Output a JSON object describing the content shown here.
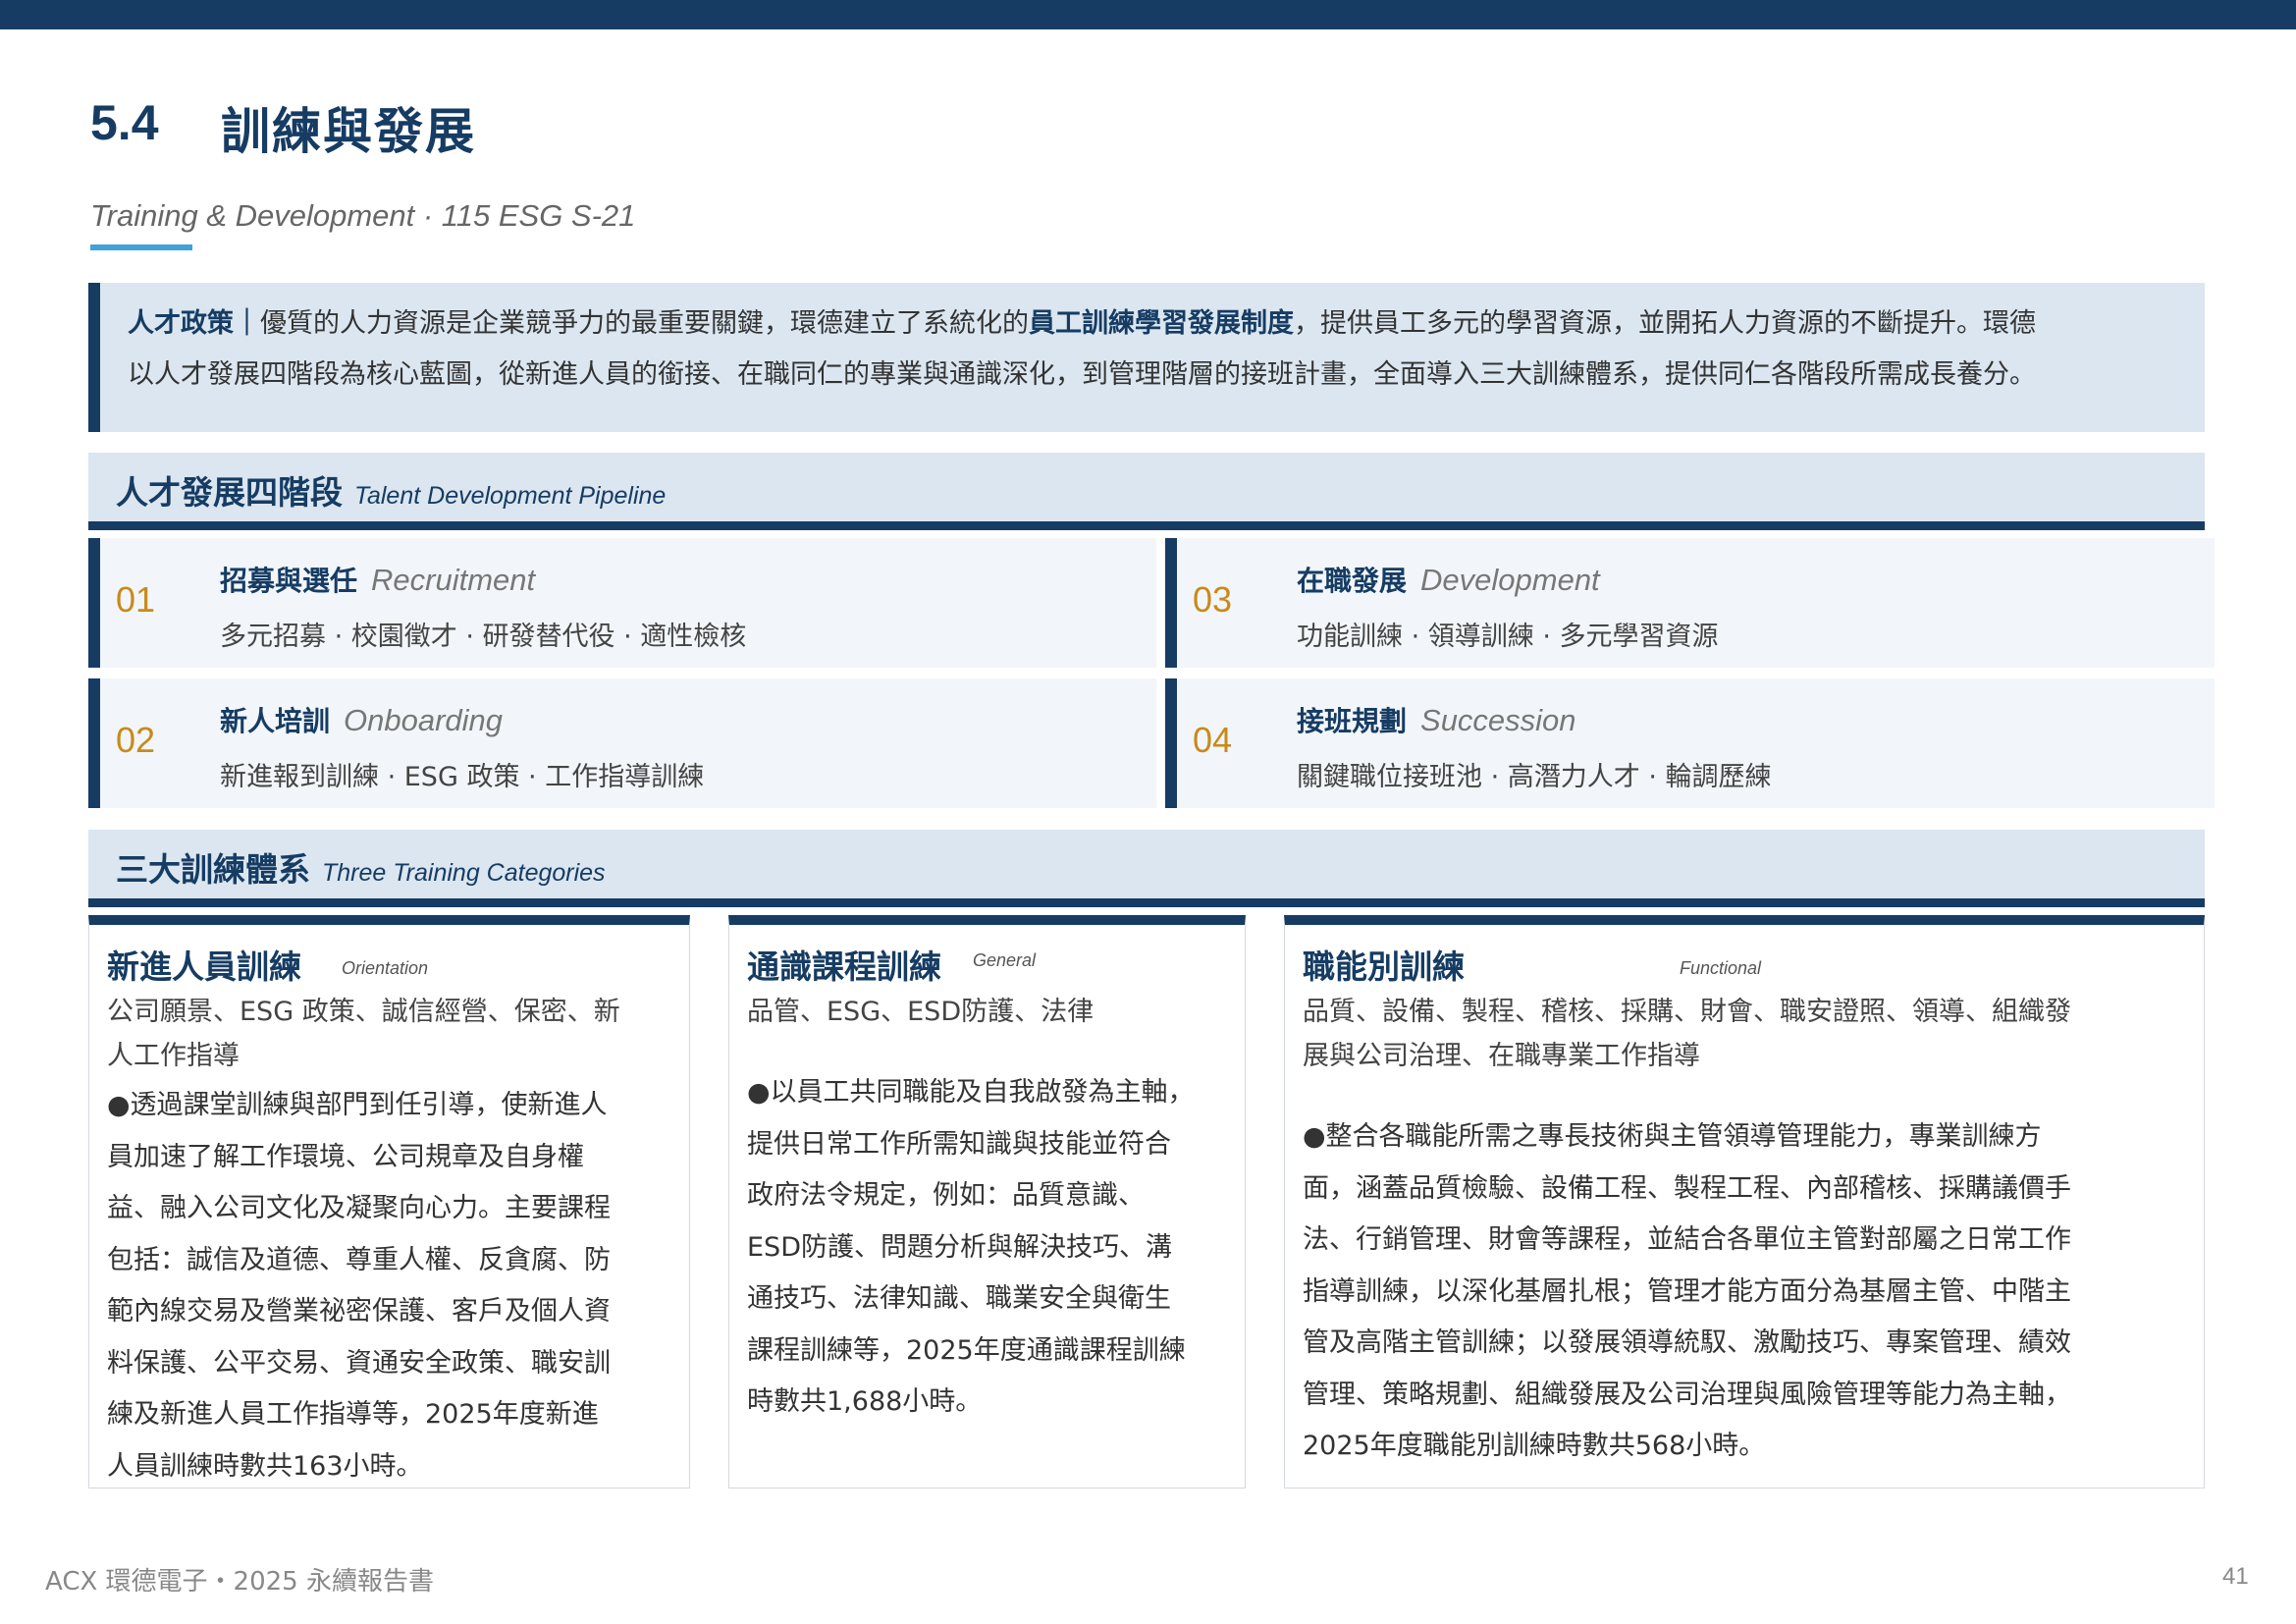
{
  "section": {
    "number": "5.4",
    "title": "訓練與發展",
    "subtitle": "Training & Development · 115 ESG S-21"
  },
  "intro": {
    "label": "人才政策｜",
    "text_1": "優質的人力資源是企業競爭力的最重要關鍵，環德建立了系統化的",
    "bold_1": "員工訓練學習發展制度",
    "text_2": "，提供員工多元的學習資源，並開拓人力資源的不斷提升。環德",
    "line2": "以人才發展四階段為核心藍圖，從新進人員的銜接、在職同仁的專業與通識深化，到管理階層的接班計畫，全面導入三大訓練體系，提供同仁各階段所需成長養分。"
  },
  "pipeline": {
    "title_zh": "人才發展四階段",
    "title_en": "Talent Development Pipeline",
    "stages": [
      {
        "num": "01",
        "name": "招募與選任",
        "name_en": "Recruitment",
        "desc": "多元招募 · 校園徵才 · 研發替代役 · 適性檢核"
      },
      {
        "num": "02",
        "name": "新人培訓",
        "name_en": "Onboarding",
        "desc": "新進報到訓練 · ESG 政策 · 工作指導訓練"
      },
      {
        "num": "03",
        "name": "在職發展",
        "name_en": "Development",
        "desc": "功能訓練 · 領導訓練 · 多元學習資源"
      },
      {
        "num": "04",
        "name": "接班規劃",
        "name_en": "Succession",
        "desc": "關鍵職位接班池 · 高潛力人才 · 輪調歷練"
      }
    ]
  },
  "training": {
    "title_zh": "三大訓練體系",
    "title_en": "Three Training Categories",
    "cards": [
      {
        "name": "新進人員訓練",
        "name_en": "Orientation",
        "topics": [
          "公司願景、ESG 政策、誠信經營、保密、新",
          "人工作指導"
        ],
        "body": [
          "●透過課堂訓練與部門到任引導，使新進人",
          "員加速了解工作環境、公司規章及自身權",
          "益、融入公司文化及凝聚向心力。主要課程",
          "包括：誠信及道德、尊重人權、反貪腐、防",
          "範內線交易及營業祕密保護、客戶及個人資",
          "料保護、公平交易、資通安全政策、職安訓",
          "練及新進人員工作指導等，2025年度新進",
          "人員訓練時數共163小時。"
        ]
      },
      {
        "name": "通識課程訓練",
        "name_en": "General",
        "topics": [
          "品管、ESG、ESD防護、法律"
        ],
        "body": [
          "●以員工共同職能及自我啟發為主軸，",
          "提供日常工作所需知識與技能並符合",
          "政府法令規定，例如：品質意識、",
          "ESD防護、問題分析與解決技巧、溝",
          "通技巧、法律知識、職業安全與衛生",
          "課程訓練等，2025年度通識課程訓練",
          "時數共1,688小時。"
        ]
      },
      {
        "name": "職能別訓練",
        "name_en": "Functional",
        "topics": [
          "品質、設備、製程、稽核、採購、財會、職安證照、領導、組織發",
          "展與公司治理、在職專業工作指導"
        ],
        "body": [
          "●整合各職能所需之專長技術與主管領導管理能力，專業訓練方",
          "面，涵蓋品質檢驗、設備工程、製程工程、內部稽核、採購議價手",
          "法、行銷管理、財會等課程，並結合各單位主管對部屬之日常工作",
          "指導訓練，以深化基層扎根；管理才能方面分為基層主管、中階主",
          "管及高階主管訓練；以發展領導統馭、激勵技巧、專案管理、績效",
          "管理、策略規劃、組織發展及公司治理與風險管理等能力為主軸，",
          "2025年度職能別訓練時數共568小時。"
        ]
      }
    ]
  },
  "footer": {
    "left": "ACX 環德電子・2025 永續報告書",
    "page": "41"
  }
}
